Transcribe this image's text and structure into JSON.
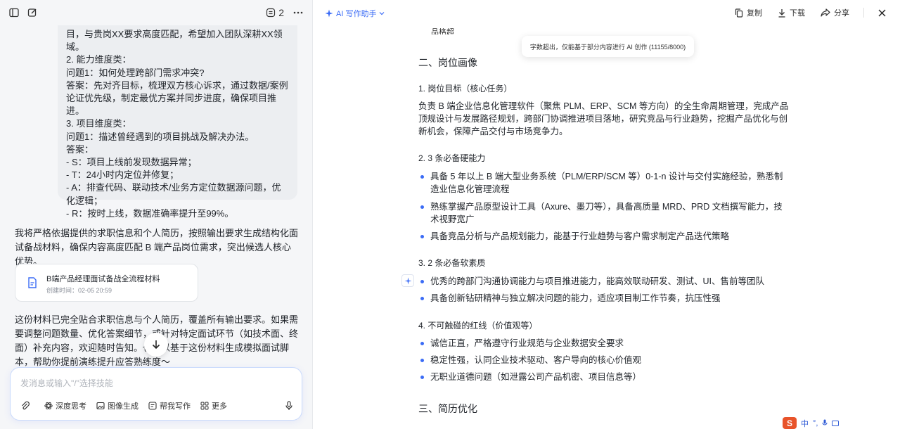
{
  "left": {
    "header": {
      "count": "2"
    },
    "user_message": [
      "目，与贵岗XX要求高度匹配，希望加入团队深耕XX领域。",
      "2. 能力维度类：",
      "问题1：如何处理跨部门需求冲突?",
      "答案：先对齐目标，梳理双方核心诉求，通过数据/案例论证优先级，制定最优方案并同步进度，确保项目推进。",
      "3. 项目维度类：",
      "问题1：描述曾经遇到的项目挑战及解决办法。",
      "答案：",
      "- S：项目上线前发现数据异常；",
      "- T：24小时内定位并修复；",
      "- A：排查代码、联动技术/业务方定位数据源问题，优化逻辑；",
      "- R：按时上线，数据准确率提升至99%。"
    ],
    "reply_intro": "我将严格依据提供的求职信息和个人简历，按照输出要求生成结构化面试备战材料，确保内容高度匹配 B 端产品岗位需求，突出候选人核心优势。",
    "doc_card": {
      "title": "B端产品经理面试备战全流程材料",
      "meta": "创建时间：02-05 20:59"
    },
    "reply_outro": "这份材料已完全贴合求职信息与个人简历，覆盖所有输出要求。如果需要调整问题数量、优化答案细节，或针对特定面试环节（如技术面、终面）补充内容，欢迎随时告知。也可以基于这份材料生成模拟面试脚本，帮助你提前演练提升应答熟练度～",
    "composer": {
      "placeholder": "发消息或输入\"/\"选择技能",
      "tools": [
        "深度思考",
        "图像生成",
        "帮我写作",
        "更多"
      ]
    }
  },
  "right": {
    "ai_button": "AI 写作助手",
    "actions": {
      "copy": "复制",
      "download": "下载",
      "share": "分享"
    },
    "tooltip": "字数超出，仅能基于部分内容进行 AI 创作 (11155/8000)",
    "partial_line": "品格超",
    "section2": "二、岗位画像",
    "s1_title": "1. 岗位目标（核心任务）",
    "s1_text": "负责 B 端企业信息化管理软件（聚焦 PLM、ERP、SCM 等方向）的全生命周期管理，完成产品顶规设计与发展路径规划，跨部门协调推进项目落地，研究竞品与行业趋势，挖掘产品优化与创新机会，保障产品交付与市场竞争力。",
    "s2_title": "2. 3 条必备硬能力",
    "s2_items": [
      "具备 5 年以上 B 端大型业务系统（PLM/ERP/SCM 等）0-1-n 设计与交付实施经验，熟悉制造业信息化管理流程",
      "熟练掌握产品原型设计工具（Axure、墨刀等），具备高质量 MRD、PRD 文档撰写能力，技术视野宽广",
      "具备竞品分析与产品规划能力，能基于行业趋势与客户需求制定产品迭代策略"
    ],
    "s3_title": "3. 2 条必备软素质",
    "s3_items": [
      "优秀的跨部门沟通协调能力与项目推进能力，能高效联动研发、测试、UI、售前等团队",
      "具备创新钻研精神与独立解决问题的能力，适应项目制工作节奏，抗压性强"
    ],
    "s4_title": "4. 不可触碰的红线（价值观等）",
    "s4_items": [
      "诚信正直，严格遵守行业规范与企业数据安全要求",
      "稳定性强，认同企业技术驱动、客户导向的核心价值观",
      "无职业道德问题（如泄露公司产品机密、项目信息等）"
    ],
    "section3": "三、简历优化",
    "ime": {
      "lang": "中",
      "sep": "°,"
    }
  },
  "colors": {
    "accent": "#3b6cf6",
    "panel_bg": "#f5f6f8",
    "bubble_bg": "#eceef1"
  }
}
